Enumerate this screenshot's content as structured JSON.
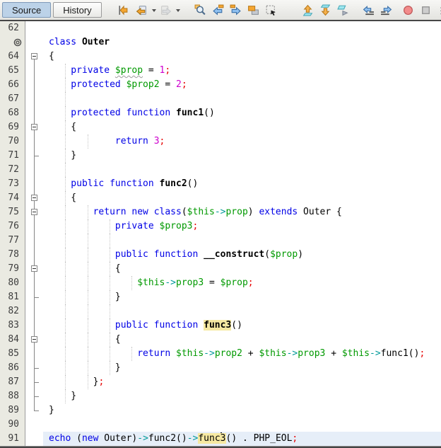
{
  "toolbar": {
    "tabs": [
      {
        "label": "Source",
        "active": true
      },
      {
        "label": "History",
        "active": false
      }
    ],
    "groups": [
      [
        "jump-last-edit"
      ],
      [
        "back",
        "forward"
      ],
      [
        "find-selection",
        "find-previous",
        "find-next",
        "toggle-highlight",
        "select-rectangular"
      ],
      [
        "previous-bookmark",
        "next-bookmark",
        "toggle-bookmark"
      ],
      [
        "shift-line-left",
        "shift-line-right"
      ],
      [
        "start-macro-recording",
        "stop-macro-recording"
      ],
      [
        "toggle-comment",
        "indent"
      ]
    ],
    "dropdown": [
      "back",
      "forward"
    ],
    "disabled": [
      "forward"
    ]
  },
  "editor": {
    "colors": {
      "keyword": "#0000E6",
      "variable": "#009900",
      "object_operator": "#009999",
      "number": "#CE00CE",
      "semicolon": "#E60000",
      "occurrence_highlight": "#F6E9A2",
      "current_line_bg": "#E6EEF8",
      "gutter_bg": "#EAEAE2"
    },
    "current_line": "91",
    "lines": [
      {
        "n": "62",
        "i": 0,
        "g": 0,
        "f": "none",
        "t": []
      },
      {
        "n": "",
        "glyph": "annotation-circle",
        "i": 0,
        "g": 0,
        "f": "none",
        "t": [
          [
            "class ",
            "k"
          ],
          [
            "Outer",
            "b"
          ]
        ]
      },
      {
        "n": "64",
        "i": 0,
        "g": 0,
        "f": "start-first",
        "t": [
          [
            "{",
            "p"
          ]
        ]
      },
      {
        "n": "65",
        "i": 4,
        "g": 1,
        "f": "line",
        "t": [
          [
            "private ",
            "k"
          ],
          [
            "$prop",
            "vu"
          ],
          [
            " = ",
            "p"
          ],
          [
            "1",
            "n"
          ],
          [
            ";",
            "s"
          ]
        ]
      },
      {
        "n": "66",
        "i": 4,
        "g": 1,
        "f": "line",
        "t": [
          [
            "protected ",
            "k"
          ],
          [
            "$prop2",
            "v"
          ],
          [
            " = ",
            "p"
          ],
          [
            "2",
            "n"
          ],
          [
            ";",
            "s"
          ]
        ]
      },
      {
        "n": "67",
        "i": 0,
        "g": 1,
        "f": "line",
        "t": []
      },
      {
        "n": "68",
        "i": 4,
        "g": 1,
        "f": "line",
        "t": [
          [
            "protected function ",
            "k"
          ],
          [
            "func1",
            "b"
          ],
          [
            "()",
            "p"
          ]
        ]
      },
      {
        "n": "69",
        "i": 4,
        "g": 1,
        "f": "start",
        "t": [
          [
            "{",
            "p"
          ]
        ]
      },
      {
        "n": "70",
        "i": 12,
        "g": 2,
        "f": "line",
        "t": [
          [
            "return ",
            "k"
          ],
          [
            "3",
            "n"
          ],
          [
            ";",
            "s"
          ]
        ]
      },
      {
        "n": "71",
        "i": 4,
        "g": 1,
        "f": "tick",
        "t": [
          [
            "}",
            "p"
          ]
        ]
      },
      {
        "n": "72",
        "i": 0,
        "g": 1,
        "f": "line",
        "t": []
      },
      {
        "n": "73",
        "i": 4,
        "g": 1,
        "f": "line",
        "t": [
          [
            "public function ",
            "k"
          ],
          [
            "func2",
            "b"
          ],
          [
            "()",
            "p"
          ]
        ]
      },
      {
        "n": "74",
        "i": 4,
        "g": 1,
        "f": "start",
        "t": [
          [
            "{",
            "p"
          ]
        ]
      },
      {
        "n": "75",
        "i": 8,
        "g": 2,
        "f": "start",
        "t": [
          [
            "return new class",
            "k"
          ],
          [
            "(",
            "p"
          ],
          [
            "$this",
            "v"
          ],
          [
            "->",
            "o"
          ],
          [
            "prop",
            "v"
          ],
          [
            ") ",
            "p"
          ],
          [
            "extends",
            "k"
          ],
          [
            " Outer {",
            "p"
          ]
        ]
      },
      {
        "n": "76",
        "i": 12,
        "g": 3,
        "f": "line",
        "t": [
          [
            "private ",
            "k"
          ],
          [
            "$prop3",
            "v"
          ],
          [
            ";",
            "s"
          ]
        ]
      },
      {
        "n": "77",
        "i": 0,
        "g": 3,
        "f": "line",
        "t": []
      },
      {
        "n": "78",
        "i": 12,
        "g": 3,
        "f": "line",
        "t": [
          [
            "public function ",
            "k"
          ],
          [
            "__construct",
            "b"
          ],
          [
            "(",
            "p"
          ],
          [
            "$prop",
            "v"
          ],
          [
            ")",
            "p"
          ]
        ]
      },
      {
        "n": "79",
        "i": 12,
        "g": 3,
        "f": "start",
        "t": [
          [
            "{",
            "p"
          ]
        ]
      },
      {
        "n": "80",
        "i": 16,
        "g": 4,
        "f": "line",
        "t": [
          [
            "$this",
            "v"
          ],
          [
            "->",
            "o"
          ],
          [
            "prop3",
            "v"
          ],
          [
            " = ",
            "p"
          ],
          [
            "$prop",
            "v"
          ],
          [
            ";",
            "s"
          ]
        ]
      },
      {
        "n": "81",
        "i": 12,
        "g": 3,
        "f": "tick",
        "t": [
          [
            "}",
            "p"
          ]
        ]
      },
      {
        "n": "82",
        "i": 0,
        "g": 3,
        "f": "line",
        "t": []
      },
      {
        "n": "83",
        "i": 12,
        "g": 3,
        "f": "line",
        "t": [
          [
            "public function ",
            "k"
          ],
          [
            "func3",
            "hb"
          ],
          [
            "()",
            "p"
          ]
        ]
      },
      {
        "n": "84",
        "i": 12,
        "g": 3,
        "f": "start",
        "t": [
          [
            "{",
            "p"
          ]
        ]
      },
      {
        "n": "85",
        "i": 16,
        "g": 4,
        "f": "line",
        "t": [
          [
            "return ",
            "k"
          ],
          [
            "$this",
            "v"
          ],
          [
            "->",
            "o"
          ],
          [
            "prop2",
            "v"
          ],
          [
            " + ",
            "p"
          ],
          [
            "$this",
            "v"
          ],
          [
            "->",
            "o"
          ],
          [
            "prop3",
            "v"
          ],
          [
            " + ",
            "p"
          ],
          [
            "$this",
            "v"
          ],
          [
            "->",
            "o"
          ],
          [
            "func1()",
            "p"
          ],
          [
            ";",
            "s"
          ]
        ]
      },
      {
        "n": "86",
        "i": 12,
        "g": 3,
        "f": "tick",
        "t": [
          [
            "}",
            "p"
          ]
        ]
      },
      {
        "n": "87",
        "i": 8,
        "g": 2,
        "f": "tick",
        "t": [
          [
            "}",
            "p"
          ],
          [
            ";",
            "s"
          ]
        ]
      },
      {
        "n": "88",
        "i": 4,
        "g": 1,
        "f": "tick",
        "t": [
          [
            "}",
            "p"
          ]
        ]
      },
      {
        "n": "89",
        "i": 0,
        "g": 0,
        "f": "corner",
        "t": [
          [
            "}",
            "p"
          ]
        ]
      },
      {
        "n": "90",
        "i": 0,
        "g": 0,
        "f": "none",
        "t": []
      },
      {
        "n": "91",
        "i": 0,
        "g": 0,
        "f": "none",
        "cur": true,
        "t": [
          [
            "echo ",
            "k"
          ],
          [
            "(",
            "p"
          ],
          [
            "new",
            "k"
          ],
          [
            " Outer)",
            "p"
          ],
          [
            "->",
            "o"
          ],
          [
            "func2()",
            "p"
          ],
          [
            "->",
            "o"
          ],
          [
            "func",
            "h"
          ],
          [
            "",
            "caret"
          ],
          [
            "3",
            "h"
          ],
          [
            "() . PHP_EOL",
            "p"
          ],
          [
            ";",
            "s"
          ]
        ]
      }
    ]
  }
}
